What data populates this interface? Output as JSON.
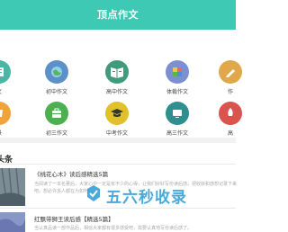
{
  "header": {
    "title": "顶点作文"
  },
  "categories": [
    {
      "label": "文",
      "icon": "book-icon",
      "color": "#4cb6a6"
    },
    {
      "label": "初中作文",
      "icon": "globe-icon",
      "color": "#5d8fc9"
    },
    {
      "label": "高中作文",
      "icon": "open-book-icon",
      "color": "#3f9b7b"
    },
    {
      "label": "体裁作文",
      "icon": "puzzle-icon",
      "color": "#7b8fd1"
    },
    {
      "label": "作",
      "icon": "pencil-icon",
      "color": "#e0a84a"
    },
    {
      "label": "景",
      "icon": "cup-icon",
      "color": "#f0a23b"
    },
    {
      "label": "初三作文",
      "icon": "bag-icon",
      "color": "#4caf50"
    },
    {
      "label": "中考作文",
      "icon": "grad-cap-icon",
      "color": "#e0c12a"
    },
    {
      "label": "高三作文",
      "icon": "screen-icon",
      "color": "#2f8f8f"
    },
    {
      "label": "高",
      "icon": "rocket-icon",
      "color": "#d9534f"
    }
  ],
  "section": {
    "title": "头条"
  },
  "articles": [
    {
      "title": "《桃花心木》读后感精选5篇",
      "text": "当阅读了一本名著后，大家心中一定是有不少的心得，让我们好好写份读后感，把收获和感想记录下来吧。想必许多人都在为如何…"
    },
    {
      "title": "红飘带狮王读后感【精选5篇】",
      "text": "当认真品读一部作品后，相信大家都有很多感受吧，需要认真地写份读后感了。"
    }
  ],
  "watermark": {
    "text": "五六秒收录"
  }
}
